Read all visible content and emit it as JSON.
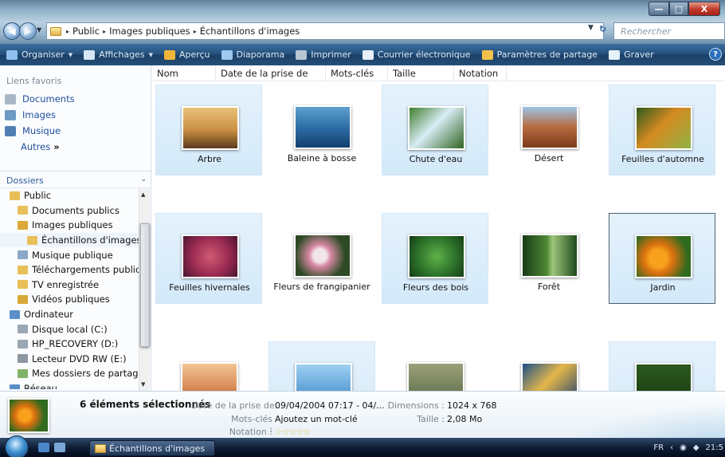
{
  "window": {
    "breadcrumb": [
      "Public",
      "Images publiques",
      "Échantillons d'images"
    ],
    "search_placeholder": "Rechercher",
    "controls": {
      "minimize": "—",
      "maximize": "□",
      "close": "X"
    }
  },
  "toolbar": {
    "items": [
      {
        "label": "Organiser",
        "icon": "organize-icon",
        "dropdown": true,
        "color": "#8fc1ef"
      },
      {
        "label": "Affichages",
        "icon": "views-icon",
        "dropdown": true,
        "color": "#d6e6f5"
      },
      {
        "label": "Aperçu",
        "icon": "preview-icon",
        "dropdown": false,
        "color": "#f0b53a"
      },
      {
        "label": "Diaporama",
        "icon": "slideshow-icon",
        "dropdown": false,
        "color": "#9fc9ee"
      },
      {
        "label": "Imprimer",
        "icon": "printer-icon",
        "dropdown": false,
        "color": "#b8c6d3"
      },
      {
        "label": "Courrier électronique",
        "icon": "mail-icon",
        "dropdown": false,
        "color": "#e7eef6"
      },
      {
        "label": "Paramètres de partage",
        "icon": "share-icon",
        "dropdown": false,
        "color": "#f3c14b"
      },
      {
        "label": "Graver",
        "icon": "burn-disc-icon",
        "dropdown": false,
        "color": "#e7f1fa"
      }
    ],
    "help": "?"
  },
  "left_pane": {
    "favorites_header": "Liens favoris",
    "favorites": [
      {
        "label": "Documents",
        "icon": "documents-icon",
        "color": "#a9b8c6"
      },
      {
        "label": "Images",
        "icon": "pictures-icon",
        "color": "#6e9ac5"
      },
      {
        "label": "Musique",
        "icon": "music-icon",
        "color": "#4f7fb3"
      }
    ],
    "more": "Autres",
    "more_chevron": "»",
    "folders_header": "Dossiers",
    "tree": [
      {
        "label": "Public",
        "indent": 1,
        "icon": "folder-icon",
        "color": "#e8bf58"
      },
      {
        "label": "Documents publics",
        "indent": 2,
        "icon": "folder-icon",
        "color": "#e8bf58"
      },
      {
        "label": "Images publiques",
        "indent": 2,
        "icon": "folder-icon",
        "color": "#d9a838"
      },
      {
        "label": "Échantillons d'images",
        "indent": 3,
        "icon": "folder-icon",
        "color": "#e8bf58",
        "selected": true
      },
      {
        "label": "Musique publique",
        "indent": 2,
        "icon": "music-folder-icon",
        "color": "#8aa9c9"
      },
      {
        "label": "Téléchargements publics",
        "indent": 2,
        "icon": "folder-icon",
        "color": "#e8bf58"
      },
      {
        "label": "TV enregistrée",
        "indent": 2,
        "icon": "folder-icon",
        "color": "#e8bf58"
      },
      {
        "label": "Vidéos publiques",
        "indent": 2,
        "icon": "folder-icon",
        "color": "#d9a838"
      },
      {
        "label": "Ordinateur",
        "indent": 1,
        "icon": "computer-icon",
        "color": "#5c8fc9"
      },
      {
        "label": "Disque local (C:)",
        "indent": 2,
        "icon": "drive-icon",
        "color": "#9aa7b4"
      },
      {
        "label": "HP_RECOVERY (D:)",
        "indent": 2,
        "icon": "drive-icon",
        "color": "#9aa7b4"
      },
      {
        "label": "Lecteur DVD RW (E:)",
        "indent": 2,
        "icon": "dvd-drive-icon",
        "color": "#8c97a2"
      },
      {
        "label": "Mes dossiers de partage",
        "indent": 2,
        "icon": "shared-folder-icon",
        "color": "#7fb36a"
      },
      {
        "label": "Réseau",
        "indent": 1,
        "icon": "network-icon",
        "color": "#5c8fc9"
      }
    ]
  },
  "columns": [
    "Nom",
    "Date de la prise de vue",
    "Mots-clés",
    "Taille",
    "Notation"
  ],
  "files": [
    {
      "name": "Arbre",
      "selected": true,
      "focus": false,
      "bg": "linear-gradient(180deg,#e8c27a 0%,#c98f42 55%,#5b3a1c 100%)"
    },
    {
      "name": "Baleine à bosse",
      "selected": false,
      "focus": false,
      "bg": "linear-gradient(180deg,#5fa0cf 0%,#2d6ea7 50%,#133f6d 100%)"
    },
    {
      "name": "Chute d'eau",
      "selected": true,
      "focus": false,
      "bg": "linear-gradient(135deg,#3f7d2c 0%,#d8ecf4 45%,#2e6320 100%)"
    },
    {
      "name": "Désert",
      "selected": false,
      "focus": false,
      "bg": "linear-gradient(180deg,#9cc3e5 0%,#b86a3e 50%,#7a3a1c 100%)"
    },
    {
      "name": "Feuilles d'automne",
      "selected": true,
      "focus": false,
      "bg": "linear-gradient(135deg,#2e5a1e 0%,#d58a21 45%,#8fb345 100%)"
    },
    {
      "name": "Feuilles hivernales",
      "selected": true,
      "focus": false,
      "bg": "radial-gradient(circle,#d05a72 0%,#9a2b52 55%,#4a1630 100%)"
    },
    {
      "name": "Fleurs de frangipanier",
      "selected": false,
      "focus": false,
      "bg": "radial-gradient(circle at 45% 50%,#f3e6ea 0 18%,#d88aa4 30%,#2d4a24 70%)"
    },
    {
      "name": "Fleurs des bois",
      "selected": true,
      "focus": false,
      "bg": "radial-gradient(circle at 50% 50%,#5fb24a 0%,#2a6e28 60%,#153d16 100%)"
    },
    {
      "name": "Forêt",
      "selected": false,
      "focus": false,
      "bg": "linear-gradient(90deg,#183a18 0%,#4d8a35 45%,#9fc77b 55%,#1e4a1c 100%)"
    },
    {
      "name": "Jardin",
      "selected": true,
      "focus": true,
      "bg": "radial-gradient(circle at 40% 55%,#f7a11c 0 22%,#d9700f 38%,#2f6a1f 75%)"
    },
    {
      "name": "",
      "selected": false,
      "focus": false,
      "bg": "linear-gradient(180deg,#f3c596 0%,#d78a55 60%,#a55a2e 100%)"
    },
    {
      "name": "",
      "selected": true,
      "focus": false,
      "bg": "linear-gradient(180deg,#9fd0f2 0%,#3a86c6 100%)"
    },
    {
      "name": "",
      "selected": false,
      "focus": false,
      "bg": "linear-gradient(180deg,#9aa07a 0%,#5a6b46 100%)"
    },
    {
      "name": "",
      "selected": false,
      "focus": false,
      "bg": "linear-gradient(135deg,#1d4f8a 0%,#e4b74a 45%,#1a3f72 100%)"
    },
    {
      "name": "",
      "selected": true,
      "focus": false,
      "bg": "linear-gradient(180deg,#2c5a1e 0%,#1a3a12 100%)"
    }
  ],
  "details": {
    "count": "6 éléments sélectionnés",
    "date_label": "Date de la prise de...",
    "date_value": "09/04/2004 07:17 - 04/...",
    "keywords_label": "Mots-clés :",
    "keywords_value": "Ajoutez un mot-clé",
    "rating_label": "Notation :",
    "rating_stars": "☆☆☆☆☆",
    "dimensions_label": "Dimensions :",
    "dimensions_value": "1024 x 768",
    "size_label": "Taille :",
    "size_value": "2,08 Mo"
  },
  "taskbar": {
    "window_button": "Échantillons d'images",
    "lang": "FR",
    "clock": "21:5"
  }
}
